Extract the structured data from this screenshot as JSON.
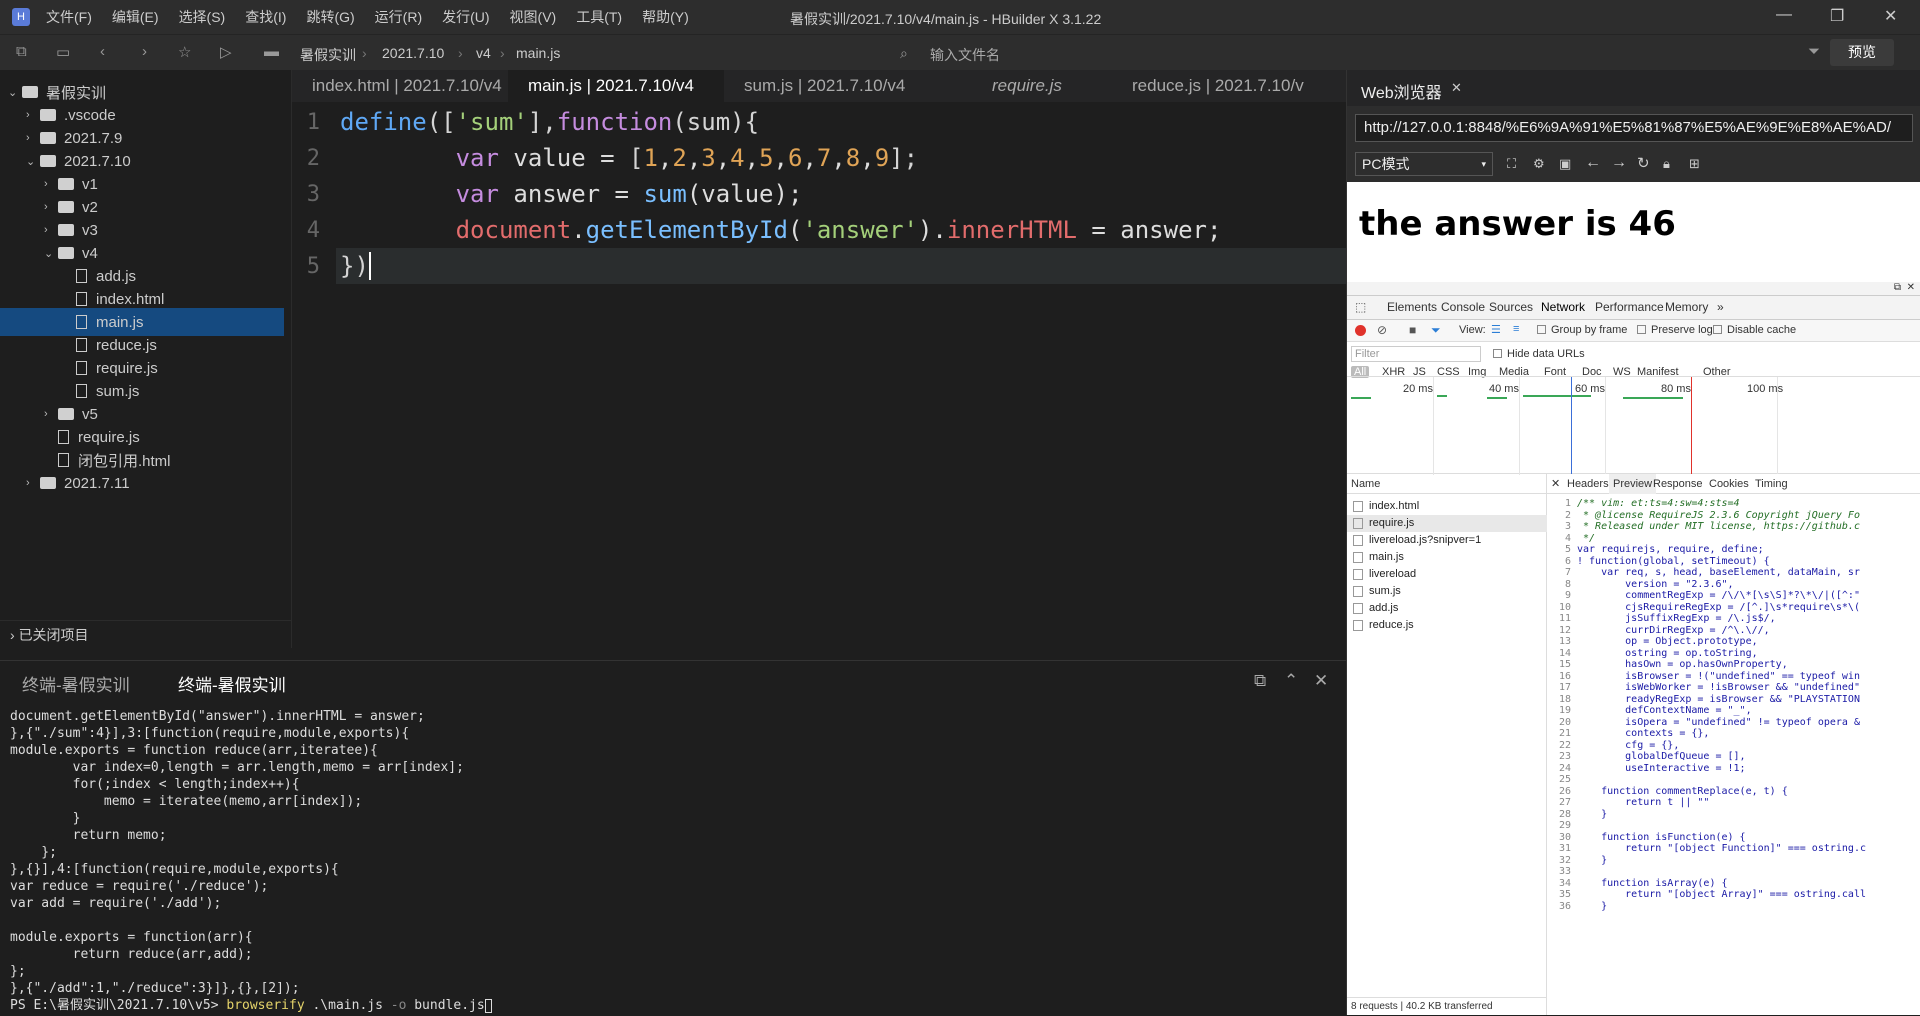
{
  "menu": {
    "items": [
      "文件(F)",
      "编辑(E)",
      "选择(S)",
      "查找(I)",
      "跳转(G)",
      "运行(R)",
      "发行(U)",
      "视图(V)",
      "工具(T)",
      "帮助(Y)"
    ],
    "window_title": "暑假实训/2021.7.10/v4/main.js - HBuilder X 3.1.22"
  },
  "toolbar": {
    "crumbs": [
      "暑假实训",
      "2021.7.10",
      "v4",
      "main.js"
    ],
    "file_input_placeholder": "输入文件名",
    "preview": "预览"
  },
  "sidebar": {
    "items": [
      {
        "label": "暑假实训",
        "type": "folder",
        "level": 0,
        "open": true
      },
      {
        "label": ".vscode",
        "type": "folder",
        "level": 1
      },
      {
        "label": "2021.7.9",
        "type": "folder",
        "level": 1
      },
      {
        "label": "2021.7.10",
        "type": "folder",
        "level": 1,
        "open": true
      },
      {
        "label": "v1",
        "type": "folder",
        "level": 2
      },
      {
        "label": "v2",
        "type": "folder",
        "level": 2
      },
      {
        "label": "v3",
        "type": "folder",
        "level": 2
      },
      {
        "label": "v4",
        "type": "folder",
        "level": 2,
        "open": true
      },
      {
        "label": "add.js",
        "type": "file",
        "level": 3
      },
      {
        "label": "index.html",
        "type": "file",
        "level": 3
      },
      {
        "label": "main.js",
        "type": "file",
        "level": 3,
        "selected": true
      },
      {
        "label": "reduce.js",
        "type": "file",
        "level": 3
      },
      {
        "label": "require.js",
        "type": "file",
        "level": 3
      },
      {
        "label": "sum.js",
        "type": "file",
        "level": 3
      },
      {
        "label": "v5",
        "type": "folder",
        "level": 2
      },
      {
        "label": "require.js",
        "type": "file",
        "level": 2
      },
      {
        "label": "闭包引用.html",
        "type": "file",
        "level": 2
      },
      {
        "label": "2021.7.11",
        "type": "folder",
        "level": 1
      }
    ],
    "closed": "已关闭项目"
  },
  "tabs": [
    "index.html | 2021.7.10/v4",
    "main.js | 2021.7.10/v4",
    "sum.js | 2021.7.10/v4",
    "require.js",
    "reduce.js | 2021.7.10/v"
  ],
  "editor": {
    "line_numbers": [
      "1",
      "2",
      "3",
      "4",
      "5"
    ]
  },
  "terminal": {
    "tabs": [
      "终端-暑假实训",
      "终端-暑假实训"
    ],
    "lines": [
      "document.getElementById(\"answer\").innerHTML = answer;",
      "},{\"./sum\":4}],3:[function(require,module,exports){",
      "module.exports = function reduce(arr,iteratee){",
      "        var index=0,length = arr.length,memo = arr[index];",
      "        for(;index < length;index++){",
      "            memo = iteratee(memo,arr[index]);",
      "        }",
      "        return memo;",
      "    };",
      "},{}],4:[function(require,module,exports){",
      "var reduce = require('./reduce');",
      "var add = require('./add');",
      "",
      "module.exports = function(arr){",
      "        return reduce(arr,add);",
      "};",
      "},{\"./add\":1,\"./reduce\":3}]},{},[2]);"
    ],
    "prompt": "PS E:\\暑假实训\\2021.7.10\\v5> ",
    "command": "browserify",
    "args": " .\\main.js ",
    "flag": "-o",
    "out": " bundle.js"
  },
  "browser": {
    "tab": "Web浏览器",
    "url": "http://127.0.0.1:8848/%E6%9A%91%E5%81%87%E5%AE%9E%E8%AE%AD/",
    "mode": "PC模式",
    "answer": "the answer is 46"
  },
  "devtools": {
    "tabs": [
      "Elements",
      "Console",
      "Sources",
      "Network",
      "Performance",
      "Memory"
    ],
    "view_label": "View:",
    "group_by_frame": "Group by frame",
    "preserve_log": "Preserve log",
    "disable_cache": "Disable cache",
    "filter_placeholder": "Filter",
    "hide_data_urls": "Hide data URLs",
    "types": [
      "All",
      "XHR",
      "JS",
      "CSS",
      "Img",
      "Media",
      "Font",
      "Doc",
      "WS",
      "Manifest",
      "Other"
    ],
    "timeline": [
      "20 ms",
      "40 ms",
      "60 ms",
      "80 ms",
      "100 ms"
    ],
    "name_header": "Name",
    "requests": [
      "index.html",
      "require.js",
      "livereload.js?snipver=1",
      "main.js",
      "livereload",
      "sum.js",
      "add.js",
      "reduce.js"
    ],
    "detail_tabs": [
      "Headers",
      "Preview",
      "Response",
      "Cookies",
      "Timing"
    ],
    "status": [
      "8 requests",
      "40.2 KB transferred"
    ]
  }
}
